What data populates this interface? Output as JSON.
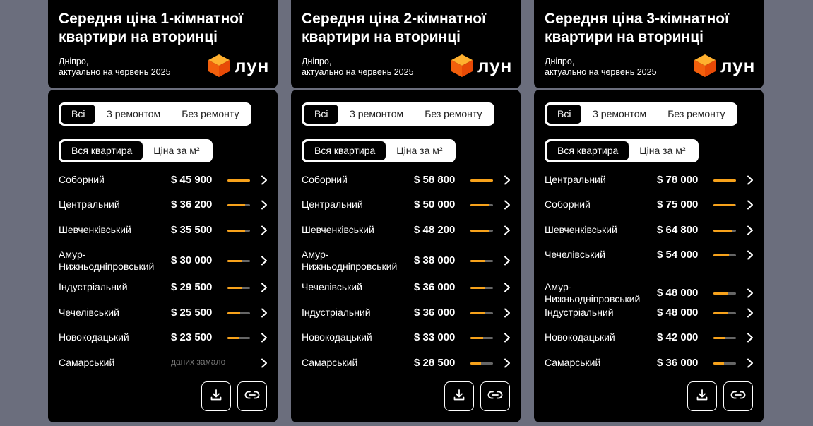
{
  "colors": {
    "accent": "#f7a21b",
    "bar_track": "#666666",
    "background": "#6b6e7d",
    "card": "#000000"
  },
  "cards": [
    {
      "title": "Середня ціна 1-кімнатної квартири на вторинці",
      "city": "Дніпро,",
      "updated": "актуально на червень 2025",
      "brand": "лун",
      "filters": [
        "Всі",
        "З ремонтом",
        "Без ремонту"
      ],
      "views": [
        "Вся квартира",
        "Ціна за м²"
      ],
      "rows": [
        {
          "name": "Соборний",
          "price": "$ 45 900",
          "fill": 1.0
        },
        {
          "name": "Центральний",
          "price": "$ 36 200",
          "fill": 0.79
        },
        {
          "name": "Шевченківський",
          "price": "$ 35 500",
          "fill": 0.77
        },
        {
          "name": "Амур-Нижньодніпровський",
          "price": "$ 30 000",
          "fill": 0.65
        },
        {
          "name": "Індустріальний",
          "price": "$ 29 500",
          "fill": 0.64
        },
        {
          "name": "Чечелівський",
          "price": "$ 25 500",
          "fill": 0.56
        },
        {
          "name": "Новокодацький",
          "price": "$ 23 500",
          "fill": 0.51
        },
        {
          "name": "Самарський",
          "price": "даних замало",
          "fill": null
        }
      ],
      "actions": [
        "download-icon",
        "link-icon"
      ]
    },
    {
      "title": "Середня ціна 2-кімнатної квартири на вторинці",
      "city": "Дніпро,",
      "updated": "актуально на червень 2025",
      "brand": "лун",
      "filters": [
        "Всі",
        "З ремонтом",
        "Без ремонту"
      ],
      "views": [
        "Вся квартира",
        "Ціна за м²"
      ],
      "rows": [
        {
          "name": "Соборний",
          "price": "$ 58 800",
          "fill": 1.0
        },
        {
          "name": "Центральний",
          "price": "$ 50 000",
          "fill": 0.85
        },
        {
          "name": "Шевченківський",
          "price": "$ 48 200",
          "fill": 0.82
        },
        {
          "name": "Амур-Нижньодніпровський",
          "price": "$ 38 000",
          "fill": 0.65
        },
        {
          "name": "Чечелівський",
          "price": "$ 36 000",
          "fill": 0.61
        },
        {
          "name": "Індустріальний",
          "price": "$ 36 000",
          "fill": 0.61
        },
        {
          "name": "Новокодацький",
          "price": "$ 33 000",
          "fill": 0.56
        },
        {
          "name": "Самарський",
          "price": "$ 28 500",
          "fill": 0.48
        }
      ],
      "actions": [
        "download-icon",
        "link-icon"
      ]
    },
    {
      "title": "Середня ціна 3-кімнатної квартири на вторинці",
      "city": "Дніпро,",
      "updated": "актуально на червень 2025",
      "brand": "лун",
      "filters": [
        "Всі",
        "З ремонтом",
        "Без ремонту"
      ],
      "views": [
        "Вся квартира",
        "Ціна за м²"
      ],
      "rows": [
        {
          "name": "Центральний",
          "price": "$ 78 000",
          "fill": 1.0
        },
        {
          "name": "Соборний",
          "price": "$ 75 000",
          "fill": 0.96
        },
        {
          "name": "Шевченківський",
          "price": "$ 64 800",
          "fill": 0.83
        },
        {
          "name": "Чечелівський",
          "price": "$ 54 000",
          "fill": 0.69
        },
        {
          "name": "Амур-Нижньодніпровський",
          "price": "$ 48 000",
          "fill": 0.62
        },
        {
          "name": "Індустріальний",
          "price": "$ 48 000",
          "fill": 0.62
        },
        {
          "name": "Новокодацький",
          "price": "$ 42 000",
          "fill": 0.54
        },
        {
          "name": "Самарський",
          "price": "$ 36 000",
          "fill": 0.46
        }
      ],
      "actions": [
        "download-icon",
        "link-icon"
      ]
    }
  ]
}
